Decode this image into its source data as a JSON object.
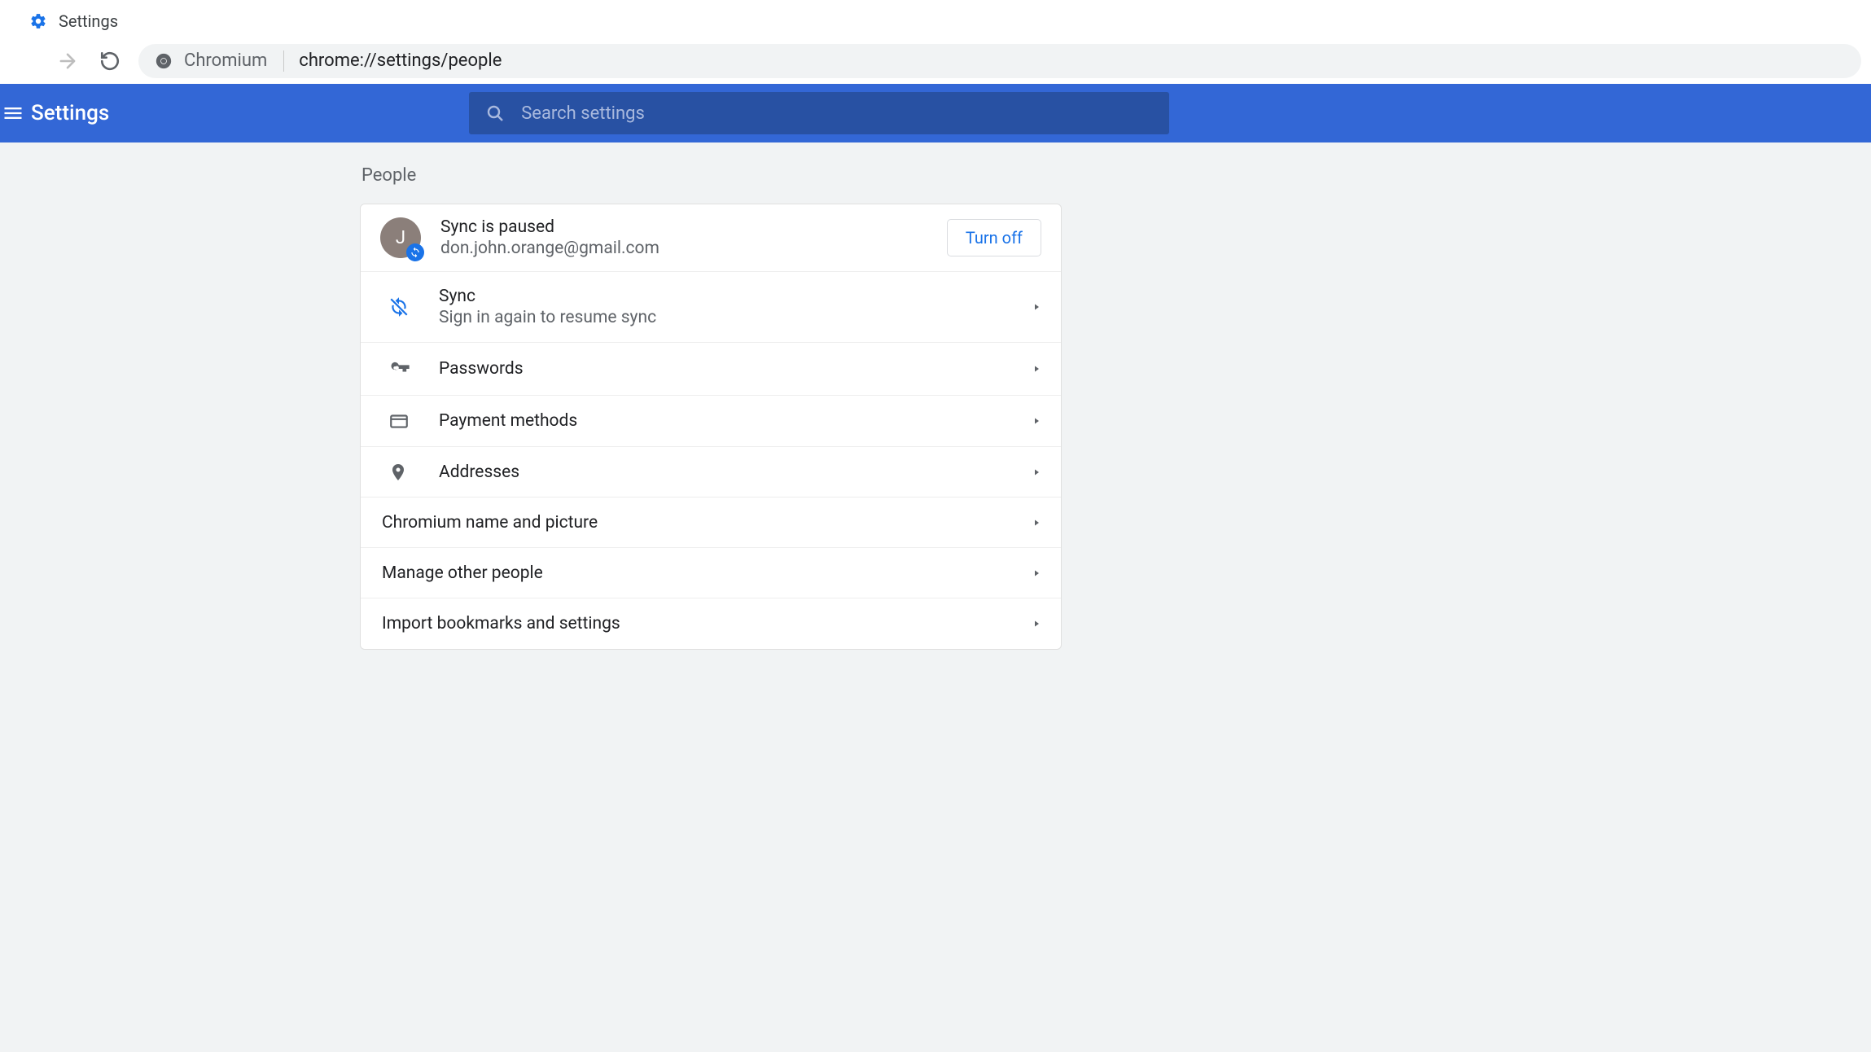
{
  "tab": {
    "title": "Settings"
  },
  "toolbar": {
    "site_label": "Chromium",
    "url": "chrome://settings/people"
  },
  "header": {
    "app_title": "Settings",
    "search_placeholder": "Search settings"
  },
  "section": {
    "title": "People",
    "account": {
      "avatar_initial": "J",
      "status": "Sync is paused",
      "email": "don.john.orange@gmail.com",
      "turn_off_label": "Turn off"
    },
    "rows": [
      {
        "id": "sync",
        "title": "Sync",
        "subtitle": "Sign in again to resume sync"
      },
      {
        "id": "passwords",
        "title": "Passwords"
      },
      {
        "id": "payment",
        "title": "Payment methods"
      },
      {
        "id": "addresses",
        "title": "Addresses"
      },
      {
        "id": "name-picture",
        "title": "Chromium name and picture"
      },
      {
        "id": "manage-people",
        "title": "Manage other people"
      },
      {
        "id": "import",
        "title": "Import bookmarks and settings"
      }
    ]
  }
}
